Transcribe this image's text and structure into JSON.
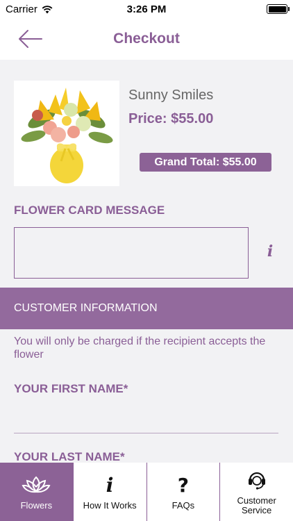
{
  "status_bar": {
    "carrier": "Carrier",
    "time": "3:26 PM"
  },
  "nav": {
    "title": "Checkout",
    "back_icon": "arrow-left-icon"
  },
  "product": {
    "name": "Sunny Smiles",
    "price": "Price: $55.00",
    "grand_total": "Grand Total: $55.00"
  },
  "card_message": {
    "label": "FLOWER CARD MESSAGE",
    "value": "",
    "info_icon": "i"
  },
  "customer_info": {
    "banner": "CUSTOMER INFORMATION",
    "note": "You will only be charged if the recipient accepts the flower",
    "first_name_label": "YOUR FIRST NAME*",
    "first_name_value": "",
    "last_name_label": "YOUR LAST NAME*"
  },
  "tabs": [
    {
      "label": "Flowers",
      "icon": "lotus-icon",
      "active": true
    },
    {
      "label": "How It Works",
      "icon": "info-icon",
      "glyph": "i"
    },
    {
      "label": "FAQs",
      "icon": "question-icon",
      "glyph": "?"
    },
    {
      "label": "Customer Service",
      "icon": "headset-icon"
    }
  ],
  "colors": {
    "accent": "#8a5e96",
    "banner": "#936a9d",
    "background": "#f2f2f4"
  }
}
